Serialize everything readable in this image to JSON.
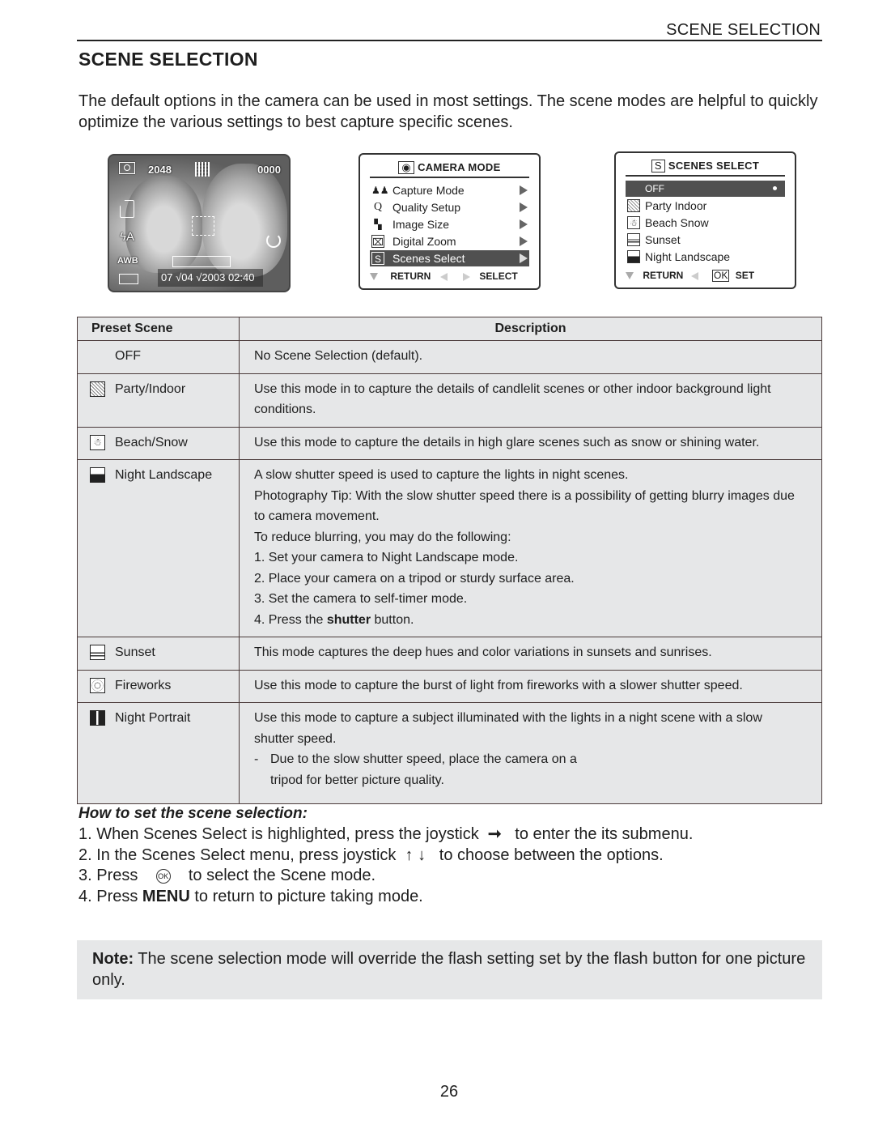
{
  "header": {
    "running_head": "SCENE SELECTION",
    "title": "SCENE SELECTION",
    "intro": "The default options in the camera can be used in most settings. The scene modes are helpful to quickly optimize the various settings to best capture specific scenes."
  },
  "lcd_preview": {
    "resolution": "2048",
    "shot_count": "0000",
    "flash": "ϟA",
    "white_balance": "AWB",
    "datetime": "07 √04 √2003  02:40",
    "icons": [
      "camera-icon",
      "image-size-grid-icon",
      "memory-card-icon",
      "flash-auto-icon",
      "self-timer-icon",
      "zoom-bar-icon",
      "battery-icon",
      "focus-frame-icon"
    ]
  },
  "camera_mode_menu": {
    "title": "CAMERA MODE",
    "items": [
      {
        "icon": "capture-mode-icon",
        "glyph": "♟♟",
        "label": "Capture Mode"
      },
      {
        "icon": "quality-icon",
        "glyph": "Q",
        "label": "Quality Setup"
      },
      {
        "icon": "image-size-icon",
        "glyph": "▚",
        "label": "Image Size"
      },
      {
        "icon": "digital-zoom-icon",
        "glyph": "⌧",
        "label": "Digital Zoom"
      },
      {
        "icon": "scenes-icon",
        "glyph": "S",
        "label": "Scenes Select",
        "selected": true
      }
    ],
    "footer_return": "RETURN",
    "footer_select": "SELECT"
  },
  "scenes_select_menu": {
    "title": "SCENES SELECT",
    "title_glyph": "S",
    "items": [
      {
        "icon": "",
        "label": "OFF",
        "selected": true
      },
      {
        "icon": "party-indoor-icon",
        "label": "Party Indoor"
      },
      {
        "icon": "beach-snow-icon",
        "label": "Beach Snow"
      },
      {
        "icon": "sunset-icon",
        "label": "Sunset"
      },
      {
        "icon": "night-landscape-icon",
        "label": "Night Landscape"
      }
    ],
    "footer_return": "RETURN",
    "footer_ok": "OK",
    "footer_set": "SET"
  },
  "table": {
    "headers": [
      "Preset Scene",
      "Description"
    ],
    "rows": [
      {
        "scene": "OFF",
        "icon": "",
        "desc": [
          "No Scene Selection (default)."
        ]
      },
      {
        "scene": "Party/Indoor",
        "icon": "party-indoor-icon",
        "desc": [
          "Use this mode in to capture the details of candlelit scenes or other indoor background light conditions."
        ]
      },
      {
        "scene": "Beach/Snow",
        "icon": "beach-snow-icon",
        "desc": [
          "Use this mode to capture the details in high glare scenes such as snow or shining water."
        ]
      },
      {
        "scene": "Night Landscape",
        "icon": "night-landscape-icon",
        "desc": [
          "A slow shutter speed is used to capture the lights in night scenes.",
          "Photography Tip: With the slow shutter speed there is a possibility of getting blurry images due to camera movement.",
          "To reduce blurring, you may do the following:",
          "1.  Set your camera to Night Landscape mode.",
          "2.  Place your camera on a tripod or sturdy surface area.",
          "3.  Set the camera to self-timer mode."
        ],
        "desc_last_prefix": "4.  Press the ",
        "desc_last_bold": "shutter",
        "desc_last_suffix": " button."
      },
      {
        "scene": "Sunset",
        "icon": "sunset-icon",
        "desc": [
          "This mode captures the deep hues and color variations in sunsets and sunrises."
        ]
      },
      {
        "scene": "Fireworks",
        "icon": "fireworks-icon",
        "desc": [
          "Use this mode to capture the burst of light from fireworks with a slower shutter speed."
        ]
      },
      {
        "scene": "Night Portrait",
        "icon": "night-portrait-icon",
        "desc": [
          "Use this mode to capture a subject illuminated with the lights in a night scene with a slow shutter speed."
        ],
        "bullet_dash": "-",
        "bullet_line1": "Due to the slow shutter speed, place the camera on a",
        "bullet_line2": "tripod for better picture quality."
      }
    ]
  },
  "howto": {
    "title": "How to set the scene selection:",
    "step1_a": "1.  When Scenes Select is highlighted, press the joystick",
    "step1_glyph": "➞",
    "step1_b": "to enter the its submenu.",
    "step2_a": "2.  In the Scenes Select  menu, press joystick",
    "step2_glyph": "↑ ↓",
    "step2_b": "to choose between the options.",
    "step3_a": "3.  Press",
    "step3_glyph": "OK",
    "step3_b": "to select the Scene mode.",
    "step4_a": "4.  Press ",
    "step4_bold": "MENU",
    "step4_b": " to return to picture taking mode."
  },
  "note": {
    "label": "Note:",
    "text": " The scene selection mode will override the flash setting set by the flash button for one picture only."
  },
  "page_number": "26"
}
